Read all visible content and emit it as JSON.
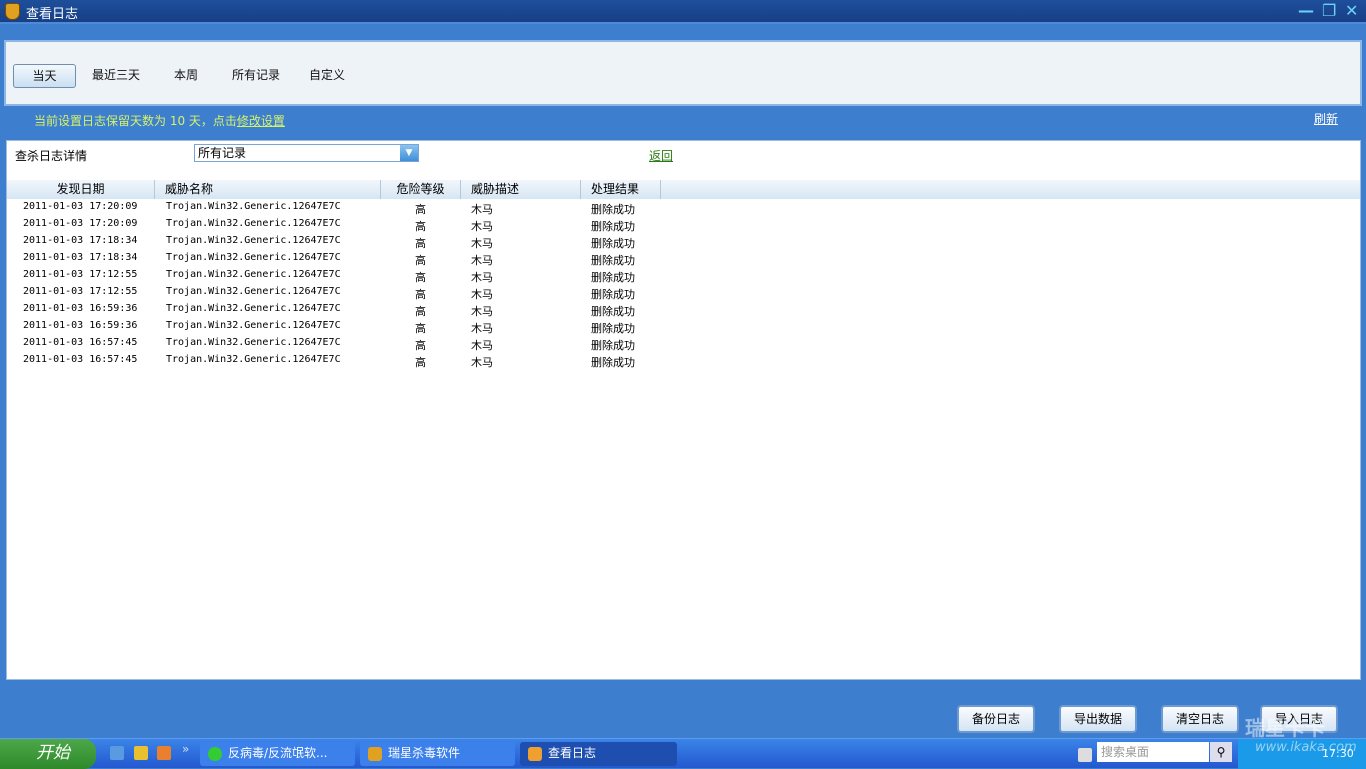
{
  "window": {
    "title": "查看日志",
    "minimize": "—",
    "restore": "❐",
    "close": "✕"
  },
  "tabs": [
    {
      "label": "当天",
      "active": true
    },
    {
      "label": "最近三天"
    },
    {
      "label": "本周"
    },
    {
      "label": "所有记录"
    },
    {
      "label": "自定义"
    }
  ],
  "notice": {
    "text": "当前设置日志保留天数为 10 天，点击",
    "link": "修改设置"
  },
  "refresh": "刷新",
  "detail": {
    "label": "查杀日志详情",
    "filter_value": "所有记录",
    "back": "返回"
  },
  "table": {
    "columns": [
      "发现日期",
      "威胁名称",
      "危险等级",
      "威胁描述",
      "处理结果"
    ],
    "rows": [
      [
        "2011-01-03 17:20:09",
        "Trojan.Win32.Generic.12647E7C",
        "高",
        "木马",
        "删除成功"
      ],
      [
        "2011-01-03 17:20:09",
        "Trojan.Win32.Generic.12647E7C",
        "高",
        "木马",
        "删除成功"
      ],
      [
        "2011-01-03 17:18:34",
        "Trojan.Win32.Generic.12647E7C",
        "高",
        "木马",
        "删除成功"
      ],
      [
        "2011-01-03 17:18:34",
        "Trojan.Win32.Generic.12647E7C",
        "高",
        "木马",
        "删除成功"
      ],
      [
        "2011-01-03 17:12:55",
        "Trojan.Win32.Generic.12647E7C",
        "高",
        "木马",
        "删除成功"
      ],
      [
        "2011-01-03 17:12:55",
        "Trojan.Win32.Generic.12647E7C",
        "高",
        "木马",
        "删除成功"
      ],
      [
        "2011-01-03 16:59:36",
        "Trojan.Win32.Generic.12647E7C",
        "高",
        "木马",
        "删除成功"
      ],
      [
        "2011-01-03 16:59:36",
        "Trojan.Win32.Generic.12647E7C",
        "高",
        "木马",
        "删除成功"
      ],
      [
        "2011-01-03 16:57:45",
        "Trojan.Win32.Generic.12647E7C",
        "高",
        "木马",
        "删除成功"
      ],
      [
        "2011-01-03 16:57:45",
        "Trojan.Win32.Generic.12647E7C",
        "高",
        "木马",
        "删除成功"
      ]
    ]
  },
  "buttons": {
    "backup": "备份日志",
    "export": "导出数据",
    "clear": "清空日志",
    "import": "导入日志"
  },
  "taskbar": {
    "start": "开始",
    "more": "»",
    "tasks": [
      "反病毒/反流氓软...",
      "瑞星杀毒软件",
      "查看日志"
    ],
    "search_placeholder": "搜索桌面",
    "clock": "17:30"
  },
  "watermark": {
    "text": "瑞星卡卡",
    "url": "www.ikaka.com"
  }
}
